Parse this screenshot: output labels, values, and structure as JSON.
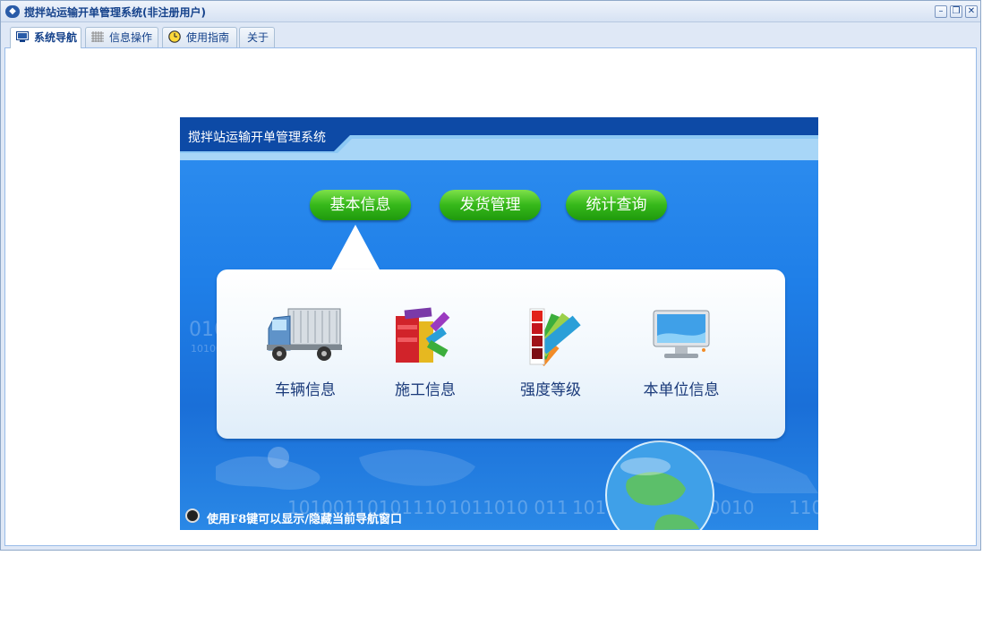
{
  "window": {
    "title": "搅拌站运输开单管理系统(非注册用户)",
    "icons": [
      "app-icon",
      "minimize-icon",
      "restore-icon",
      "close-icon"
    ]
  },
  "tabs": [
    {
      "label": "系统导航",
      "icon": "monitor-icon",
      "active": true
    },
    {
      "label": "信息操作",
      "icon": "grid-icon",
      "active": false
    },
    {
      "label": "使用指南",
      "icon": "clock-icon",
      "active": false
    },
    {
      "label": "关于",
      "icon": "",
      "active": false
    }
  ],
  "banner": {
    "title": "搅拌站运输开单管理系统",
    "nav": [
      {
        "label": "基本信息"
      },
      {
        "label": "发货管理"
      },
      {
        "label": "统计查询"
      }
    ],
    "items": [
      {
        "label": "车辆信息",
        "icon": "truck-icon"
      },
      {
        "label": "施工信息",
        "icon": "books-icon"
      },
      {
        "label": "强度等级",
        "icon": "color-swatch-icon"
      },
      {
        "label": "本单位信息",
        "icon": "monitor-icon"
      }
    ],
    "hint": "使用F8键可以显示/隐藏当前导航窗口"
  },
  "colors": {
    "title_text": "#15428b",
    "banner_blue": "#1f7fe8",
    "button_green": "#36b81a",
    "item_text": "#1a3a7a"
  }
}
